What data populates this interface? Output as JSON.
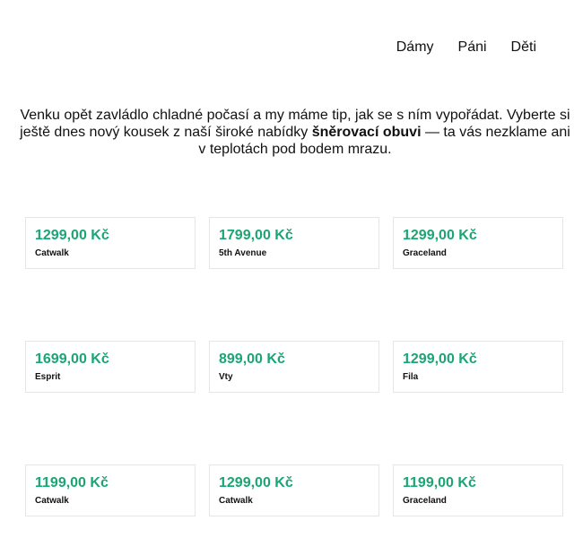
{
  "nav": {
    "items": [
      "Dámy",
      "Páni",
      "Děti"
    ]
  },
  "intro": {
    "before": "Venku opět zavládlo chladné počasí a my máme tip, jak se s ním vypořádat. Vyberte si ještě dnes nový kousek z naší široké nabídky ",
    "highlight": "šněrovací obuvi",
    "after": " — ta vás nezklame ani v teplotách pod bodem mrazu."
  },
  "products": [
    {
      "price": "1299,00 Kč",
      "brand": "Catwalk"
    },
    {
      "price": "1799,00 Kč",
      "brand": "5th Avenue"
    },
    {
      "price": "1299,00 Kč",
      "brand": "Graceland"
    },
    {
      "price": "1699,00 Kč",
      "brand": "Esprit"
    },
    {
      "price": "899,00 Kč",
      "brand": "Vty"
    },
    {
      "price": "1299,00 Kč",
      "brand": "Fila"
    },
    {
      "price": "1199,00 Kč",
      "brand": "Catwalk"
    },
    {
      "price": "1299,00 Kč",
      "brand": "Catwalk"
    },
    {
      "price": "1199,00 Kč",
      "brand": "Graceland"
    }
  ],
  "colors": {
    "price": "#1aa674",
    "text": "#111111",
    "card_border": "#e6e6e6"
  }
}
